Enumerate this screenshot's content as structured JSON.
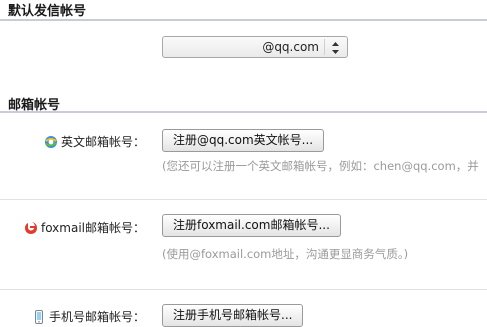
{
  "default_sender": {
    "title": "默认发信帐号",
    "selected_value": "@qq.com",
    "arrow_icon": "updown-arrows-icon"
  },
  "mailbox_accounts": {
    "title": "邮箱帐号",
    "rows": [
      {
        "icon": "qq-globe-icon",
        "label": "英文邮箱帐号：",
        "button": "注册@qq.com英文帐号...",
        "hint": "(您还可以注册一个英文邮箱帐号，例如：chen@qq.com，并"
      },
      {
        "icon": "foxmail-icon",
        "label": "foxmail邮箱帐号：",
        "button": "注册foxmail.com邮箱帐号...",
        "hint": "(使用@foxmail.com地址，沟通更显商务气质。)"
      },
      {
        "icon": "mobile-phone-icon",
        "label": "手机号邮箱帐号：",
        "button": "注册手机号邮箱帐号..."
      }
    ]
  },
  "colors": {
    "section_rule": "#c8ccd8",
    "hint_text": "#9a9a9a",
    "foxmail_red": "#e23b2e"
  }
}
